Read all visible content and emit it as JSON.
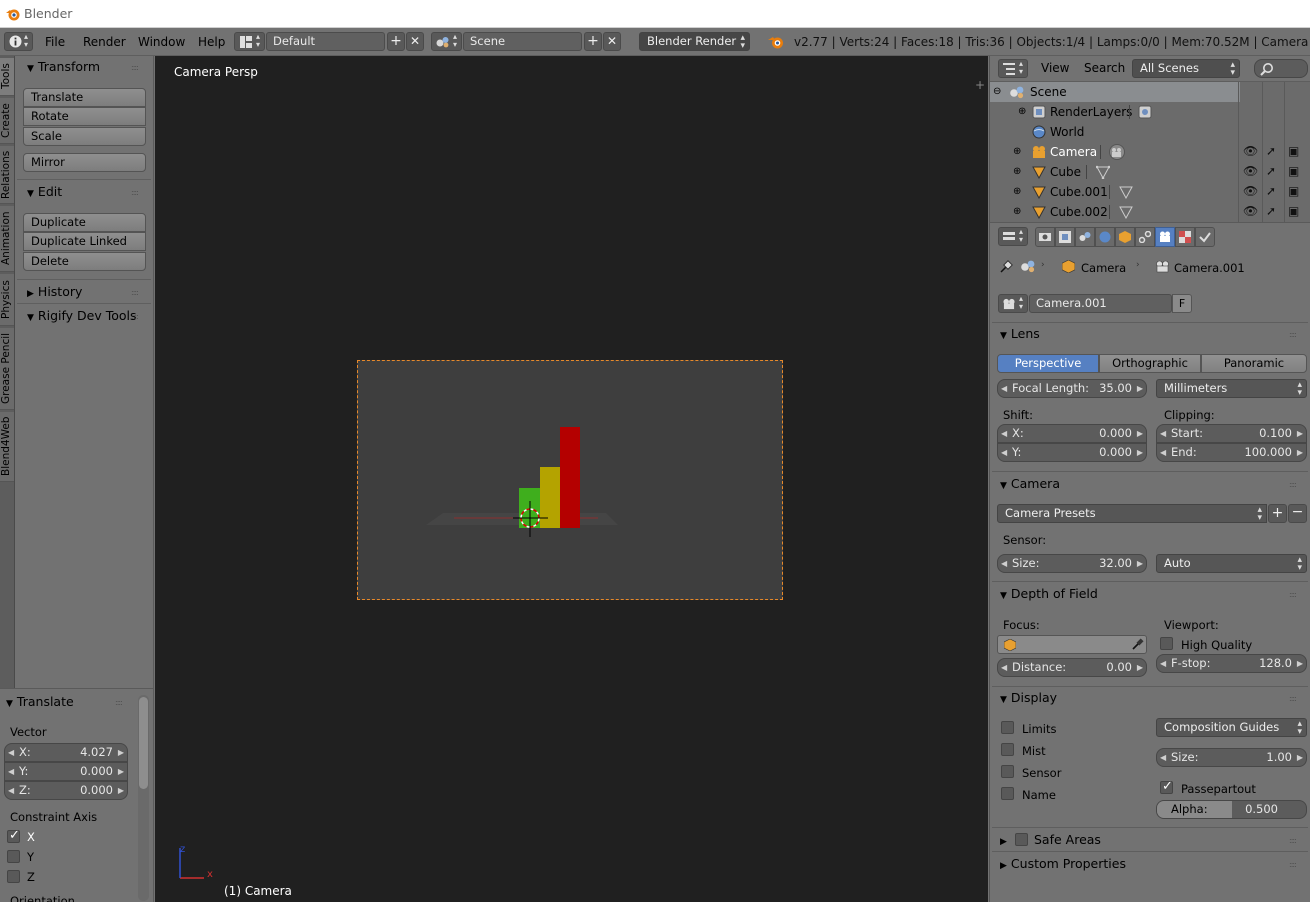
{
  "window": {
    "title": "Blender"
  },
  "info_header": {
    "menus": [
      "File",
      "Render",
      "Window",
      "Help"
    ],
    "screen_layout": "Default",
    "scene": "Scene",
    "render_engine": "Blender Render",
    "stats": "v2.77 | Verts:24 | Faces:18 | Tris:36 | Objects:1/4 | Lamps:0/0 | Mem:70.52M | Camera"
  },
  "tool_tabs": [
    "Tools",
    "Create",
    "Relations",
    "Animation",
    "Physics",
    "Grease Pencil",
    "Blend4Web"
  ],
  "tool_panel": {
    "transform": {
      "title": "Transform",
      "buttons": [
        "Translate",
        "Rotate",
        "Scale",
        "Mirror"
      ]
    },
    "edit": {
      "title": "Edit",
      "buttons": [
        "Duplicate",
        "Duplicate Linked",
        "Delete"
      ]
    },
    "history": "History",
    "rigify": "Rigify Dev Tools"
  },
  "operator_panel": {
    "title": "Translate",
    "vector_label": "Vector",
    "x": {
      "label": "X:",
      "value": "4.027"
    },
    "y": {
      "label": "Y:",
      "value": "0.000"
    },
    "z": {
      "label": "Z:",
      "value": "0.000"
    },
    "constraint_label": "Constraint Axis",
    "axes": [
      {
        "label": "X",
        "checked": true
      },
      {
        "label": "Y",
        "checked": false
      },
      {
        "label": "Z",
        "checked": false
      }
    ],
    "orientation_label": "Orientation"
  },
  "viewport": {
    "label": "Camera Persp",
    "object_label": "(1) Camera",
    "axis_x": "x",
    "axis_z": "z",
    "bar_colors": [
      "#3fae1d",
      "#b4a300",
      "#b40000"
    ]
  },
  "outliner": {
    "menus": [
      "View",
      "Search"
    ],
    "display_mode": "All Scenes",
    "rows": [
      {
        "label": "Scene",
        "indent": 0
      },
      {
        "label": "RenderLayers",
        "indent": 1
      },
      {
        "label": "World",
        "indent": 1
      },
      {
        "label": "Camera",
        "indent": 1
      },
      {
        "label": "Cube",
        "indent": 1
      },
      {
        "label": "Cube.001",
        "indent": 1
      },
      {
        "label": "Cube.002",
        "indent": 1
      }
    ]
  },
  "properties": {
    "breadcrumb": [
      "Camera",
      "Camera.001"
    ],
    "datablock": "Camera.001",
    "fake_user": "F",
    "lens": {
      "title": "Lens",
      "types": [
        "Perspective",
        "Orthographic",
        "Panoramic"
      ],
      "active_type": "Perspective",
      "focal_length_label": "Focal Length:",
      "focal_length": "35.00",
      "unit": "Millimeters",
      "shift_label": "Shift:",
      "clipping_label": "Clipping:",
      "shift_x_label": "X:",
      "shift_x": "0.000",
      "shift_y_label": "Y:",
      "shift_y": "0.000",
      "clip_start_label": "Start:",
      "clip_start": "0.100",
      "clip_end_label": "End:",
      "clip_end": "100.000"
    },
    "camera": {
      "title": "Camera",
      "presets": "Camera Presets",
      "sensor_label": "Sensor:",
      "size_label": "Size:",
      "size": "32.00",
      "fit": "Auto"
    },
    "dof": {
      "title": "Depth of Field",
      "focus_label": "Focus:",
      "viewport_label": "Viewport:",
      "high_quality": "High Quality",
      "distance_label": "Distance:",
      "distance": "0.00",
      "fstop_label": "F-stop:",
      "fstop": "128.0"
    },
    "display": {
      "title": "Display",
      "checks": [
        "Limits",
        "Mist",
        "Sensor",
        "Name"
      ],
      "guides": "Composition Guides",
      "size_label": "Size:",
      "size": "1.00",
      "passepartout": "Passepartout",
      "alpha_label": "Alpha:",
      "alpha": "0.500",
      "alpha_fraction": 0.5
    },
    "safe_areas": "Safe Areas",
    "custom_props": "Custom Properties"
  }
}
